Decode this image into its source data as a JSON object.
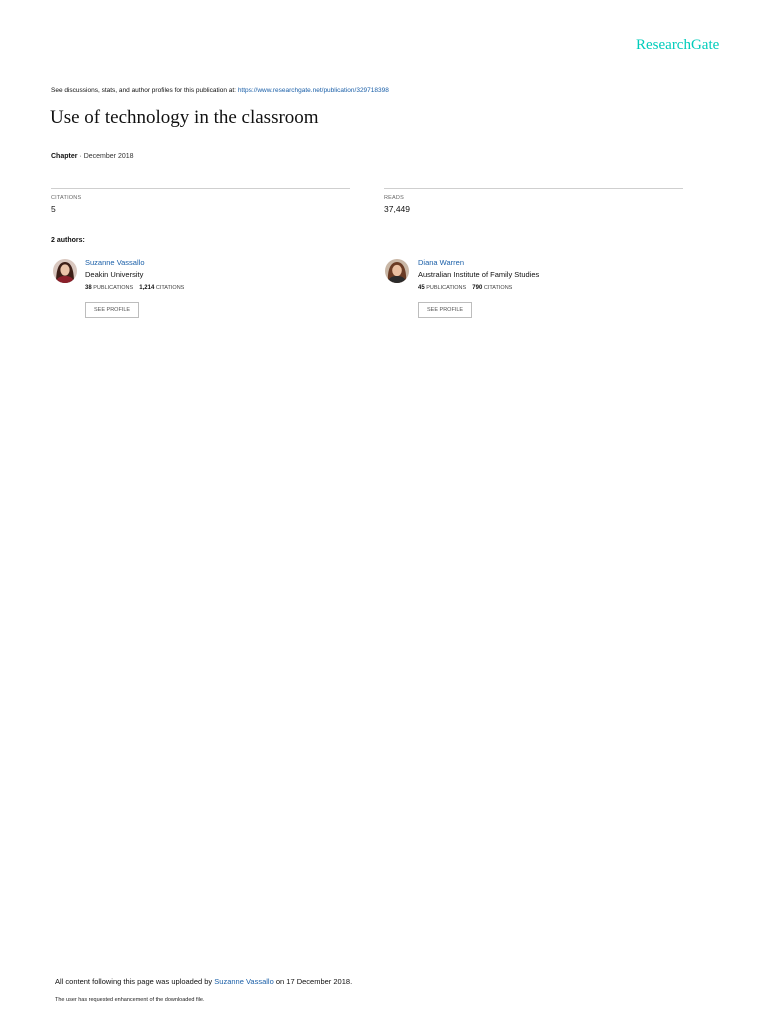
{
  "brand": {
    "logo_text": "ResearchGate"
  },
  "header": {
    "discussions_text": "See discussions, stats, and author profiles for this publication at:",
    "publication_link": "https://www.researchgate.net/publication/329718398"
  },
  "publication": {
    "title": "Use of technology in the classroom",
    "type": "Chapter",
    "separator": "·",
    "date": "December 2018"
  },
  "stats": {
    "citations_label": "CITATIONS",
    "citations_value": "5",
    "reads_label": "READS",
    "reads_value": "37,449"
  },
  "authors_heading": "2 authors:",
  "authors": [
    {
      "name": "Suzanne Vassallo",
      "affiliation": "Deakin University",
      "publications_count": "38",
      "publications_label": "PUBLICATIONS",
      "citations_count": "1,214",
      "citations_label": "CITATIONS",
      "button_label": "SEE PROFILE"
    },
    {
      "name": "Diana Warren",
      "affiliation": "Australian Institute of Family Studies",
      "publications_count": "45",
      "publications_label": "PUBLICATIONS",
      "citations_count": "790",
      "citations_label": "CITATIONS",
      "button_label": "SEE PROFILE"
    }
  ],
  "footer": {
    "upload_prefix": "All content following this page was uploaded by",
    "uploader": "Suzanne Vassallo",
    "upload_suffix": "on 17 December 2018.",
    "enhancement_note": "The user has requested enhancement of the downloaded file."
  },
  "colors": {
    "brand": "#00ccbb",
    "link": "#1a5fa8",
    "rule": "#cfcfcf"
  }
}
